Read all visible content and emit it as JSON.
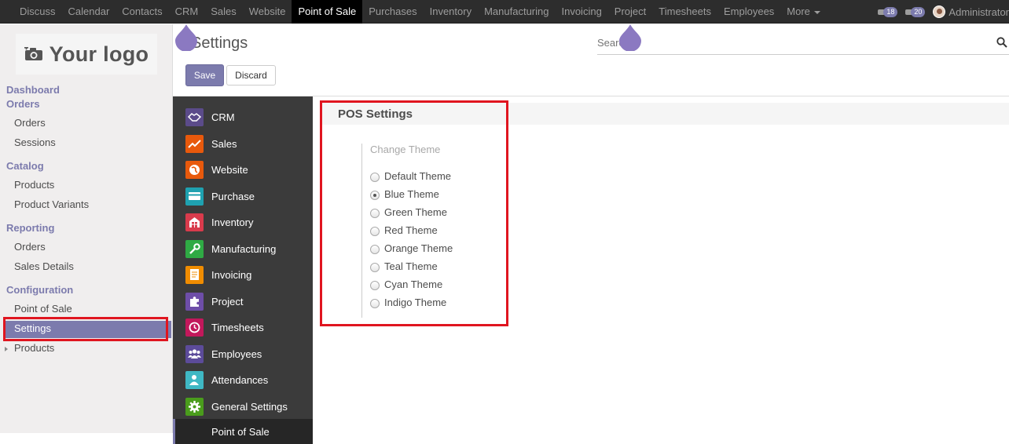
{
  "topbar": {
    "menu": [
      "Discuss",
      "Calendar",
      "Contacts",
      "CRM",
      "Sales",
      "Website",
      "Point of Sale",
      "Purchases",
      "Inventory",
      "Manufacturing",
      "Invoicing",
      "Project",
      "Timesheets",
      "Employees",
      "More"
    ],
    "active_index": 6,
    "messages_count": "18",
    "chat_count": "20",
    "user_name": "Administrator"
  },
  "sidebar": {
    "logo_text": "Your logo",
    "sections": [
      {
        "title": "Dashboard"
      },
      {
        "title": "Orders",
        "items": [
          "Orders",
          "Sessions"
        ]
      },
      {
        "title": "Catalog",
        "items": [
          "Products",
          "Product Variants"
        ]
      },
      {
        "title": "Reporting",
        "items": [
          "Orders",
          "Sales Details"
        ]
      },
      {
        "title": "Configuration",
        "items": [
          "Point of Sale",
          "Settings",
          "Products"
        ]
      }
    ],
    "active_item": "Settings"
  },
  "control_panel": {
    "title": "Settings",
    "search_placeholder": "Search...",
    "save_label": "Save",
    "discard_label": "Discard"
  },
  "apps": [
    {
      "label": "CRM",
      "icon": "crm-icon",
      "color": "#5b4b8a"
    },
    {
      "label": "Sales",
      "icon": "sales-icon",
      "color": "#e8590c"
    },
    {
      "label": "Website",
      "icon": "website-icon",
      "color": "#e8590c"
    },
    {
      "label": "Purchase",
      "icon": "purchase-icon",
      "color": "#1fa1b0"
    },
    {
      "label": "Inventory",
      "icon": "inventory-icon",
      "color": "#d93b4c"
    },
    {
      "label": "Manufacturing",
      "icon": "manufacturing-icon",
      "color": "#2faa44"
    },
    {
      "label": "Invoicing",
      "icon": "invoicing-icon",
      "color": "#f08c00"
    },
    {
      "label": "Project",
      "icon": "project-icon",
      "color": "#6e4ea8"
    },
    {
      "label": "Timesheets",
      "icon": "timesheets-icon",
      "color": "#c2185b"
    },
    {
      "label": "Employees",
      "icon": "employees-icon",
      "color": "#5c4b9a"
    },
    {
      "label": "Attendances",
      "icon": "attendances-icon",
      "color": "#3fb8c4"
    },
    {
      "label": "General Settings",
      "icon": "settings-gear-icon",
      "color": "#4a9c1c"
    },
    {
      "label": "Point of Sale",
      "icon": "pos-icon",
      "color": "#7c7bad"
    }
  ],
  "pos_settings": {
    "title": "POS Settings",
    "change_theme_label": "Change Theme",
    "themes": [
      "Default Theme",
      "Blue Theme",
      "Green Theme",
      "Red Theme",
      "Orange Theme",
      "Teal Theme",
      "Cyan Theme",
      "Indigo Theme"
    ],
    "selected_theme": "Blue Theme"
  }
}
